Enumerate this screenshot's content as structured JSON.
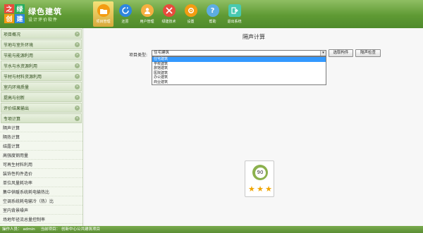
{
  "brand": {
    "logo_chars": [
      "之",
      "绿",
      "创",
      "建"
    ],
    "title": "绿色建筑",
    "subtitle": "设计评价软件"
  },
  "toolbar": [
    {
      "label": "项目管理",
      "icon": "folder-icon",
      "color": "#f39c12",
      "active": true
    },
    {
      "label": "还原",
      "icon": "restore-icon",
      "color": "#2e86de",
      "active": false
    },
    {
      "label": "用户管理",
      "icon": "user-icon",
      "color": "#f5b041",
      "active": false
    },
    {
      "label": "绿建技术",
      "icon": "tech-icon",
      "color": "#e74c3c",
      "active": false
    },
    {
      "label": "设置",
      "icon": "gear-icon",
      "color": "#f39c12",
      "active": false
    },
    {
      "label": "帮助",
      "icon": "help-icon",
      "color": "#5dade2",
      "active": false
    },
    {
      "label": "退出系统",
      "icon": "exit-icon",
      "color": "#48c9b0",
      "active": false
    }
  ],
  "sidebar": {
    "sections": [
      {
        "label": "项目概况"
      },
      {
        "label": "节地与室外环境"
      },
      {
        "label": "节能与能源利用"
      },
      {
        "label": "节水与水资源利用"
      },
      {
        "label": "节材与材料资源利用"
      },
      {
        "label": "室内环境质量"
      },
      {
        "label": "提高与创新"
      },
      {
        "label": "评价结果输出"
      },
      {
        "label": "专项计算"
      }
    ],
    "items": [
      {
        "label": "隔声计算"
      },
      {
        "label": "隔热计算"
      },
      {
        "label": "结露计算"
      },
      {
        "label": "高强度钢用量"
      },
      {
        "label": "可再生材料利用"
      },
      {
        "label": "装饰性构件造价"
      },
      {
        "label": "单位风量耗功率"
      },
      {
        "label": "集中供暖系统耗电输热比"
      },
      {
        "label": "空调系统耗电输冷（热）比"
      },
      {
        "label": "室内背景噪声"
      },
      {
        "label": "场地年径流总量控制率"
      }
    ]
  },
  "main": {
    "title": "隔声计算",
    "field_label": "项目类型:",
    "selected": "住宅建筑",
    "options": [
      "住宅建筑",
      "学校建筑",
      "旅馆建筑",
      "医院建筑",
      "办公建筑",
      "商业建筑"
    ],
    "btn_select_component": "选取构件",
    "btn_check": "隔声检查",
    "score": "90",
    "stars": [
      "★",
      "★",
      "★"
    ]
  },
  "status": {
    "operator_label": "操作人员：",
    "operator": "admin",
    "project_label": "当前项目：",
    "project": "创新中心公共建筑项目"
  }
}
